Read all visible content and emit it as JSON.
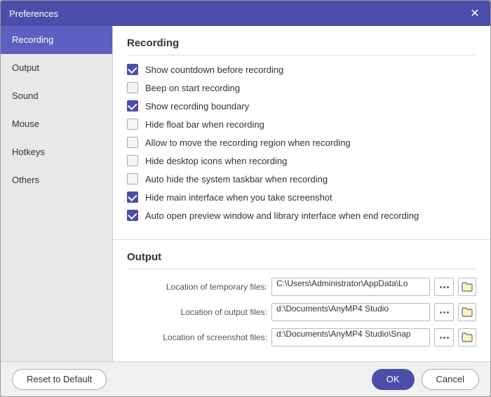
{
  "dialog": {
    "title": "Preferences",
    "close_label": "✕"
  },
  "sidebar": {
    "items": [
      {
        "id": "recording",
        "label": "Recording",
        "active": true
      },
      {
        "id": "output",
        "label": "Output",
        "active": false
      },
      {
        "id": "sound",
        "label": "Sound",
        "active": false
      },
      {
        "id": "mouse",
        "label": "Mouse",
        "active": false
      },
      {
        "id": "hotkeys",
        "label": "Hotkeys",
        "active": false
      },
      {
        "id": "others",
        "label": "Others",
        "active": false
      }
    ]
  },
  "recording_section": {
    "title": "Recording",
    "checkboxes": [
      {
        "id": "show-countdown",
        "label": "Show countdown before recording",
        "checked": true
      },
      {
        "id": "beep-start",
        "label": "Beep on start recording",
        "checked": false
      },
      {
        "id": "show-boundary",
        "label": "Show recording boundary",
        "checked": true
      },
      {
        "id": "hide-float-bar",
        "label": "Hide float bar when recording",
        "checked": false
      },
      {
        "id": "allow-move",
        "label": "Allow to move the recording region when recording",
        "checked": false
      },
      {
        "id": "hide-desktop-icons",
        "label": "Hide desktop icons when recording",
        "checked": false
      },
      {
        "id": "auto-hide-taskbar",
        "label": "Auto hide the system taskbar when recording",
        "checked": false
      },
      {
        "id": "hide-main-interface",
        "label": "Hide main interface when you take screenshot",
        "checked": true
      },
      {
        "id": "auto-open-preview",
        "label": "Auto open preview window and library interface when end recording",
        "checked": true
      }
    ]
  },
  "output_section": {
    "title": "Output",
    "fields": [
      {
        "id": "temp-files",
        "label": "Location of temporary files:",
        "value": "C:\\Users\\Administrator\\AppData\\Lo",
        "dots": "•••",
        "folder_icon": "🗁"
      },
      {
        "id": "output-files",
        "label": "Location of output files:",
        "value": "d:\\Documents\\AnyMP4 Studio",
        "dots": "•••",
        "folder_icon": "🗁"
      },
      {
        "id": "screenshot-files",
        "label": "Location of screenshot files:",
        "value": "d:\\Documents\\AnyMP4 Studio\\Snap",
        "dots": "•••",
        "folder_icon": "🗁"
      }
    ]
  },
  "footer": {
    "reset_label": "Reset to Default",
    "ok_label": "OK",
    "cancel_label": "Cancel"
  }
}
